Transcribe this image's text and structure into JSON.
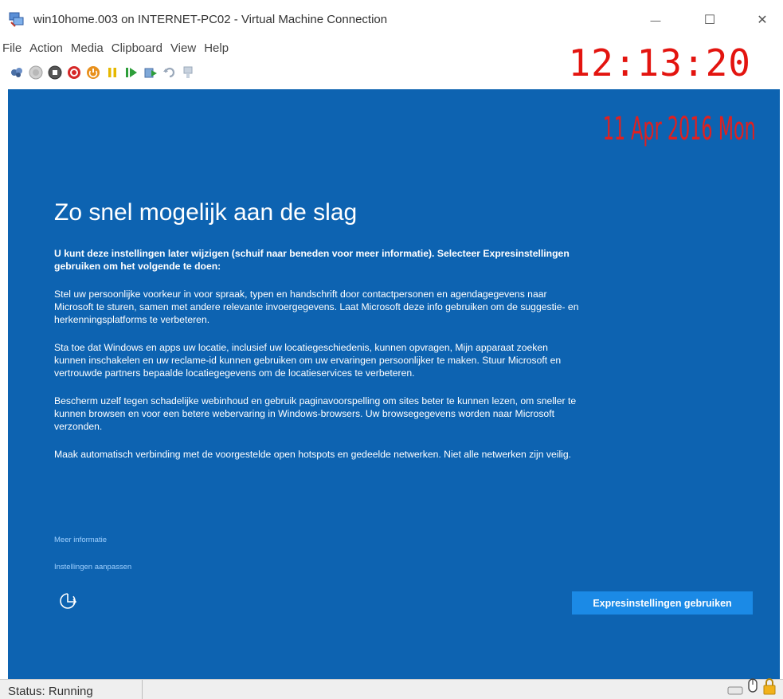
{
  "window": {
    "title": "win10home.003 on INTERNET-PC02 - Virtual Machine Connection",
    "minimize_glyph": "—",
    "maximize_glyph": "☐",
    "close_glyph": "✕"
  },
  "menu": [
    "File",
    "Action",
    "Media",
    "Clipboard",
    "View",
    "Help"
  ],
  "toolbar_icons": [
    "ctrl-alt-del-icon",
    "start-icon",
    "turn-off-icon",
    "shut-down-icon",
    "save-icon",
    "pause-icon",
    "resume-icon",
    "checkpoint-icon",
    "revert-icon",
    "enhanced-session-icon"
  ],
  "overlay": {
    "time": "12:13:20",
    "date": "11 Apr 2016 Mon",
    "color": "#e3140f"
  },
  "setup": {
    "heading": "Zo snel mogelijk aan de slag",
    "intro": "U kunt deze instellingen later wijzigen (schuif naar beneden voor meer informatie). Selecteer Expresinstellingen gebruiken om het volgende te doen:",
    "paragraphs": [
      "Stel uw persoonlijke voorkeur in voor spraak, typen en handschrift door contactpersonen en agendagegevens naar Microsoft te sturen, samen met andere relevante invoergegevens. Laat Microsoft deze info gebruiken om de suggestie- en herkenningsplatforms te verbeteren.",
      "Sta toe dat Windows en apps uw locatie, inclusief uw locatiegeschiedenis, kunnen opvragen, Mijn apparaat zoeken kunnen inschakelen en uw reclame-id kunnen gebruiken om uw ervaringen persoonlijker te maken. Stuur Microsoft en vertrouwde partners bepaalde locatiegegevens om de locatieservices te verbeteren.",
      "Bescherm uzelf tegen schadelijke webinhoud en gebruik paginavoorspelling om sites beter te kunnen lezen, om sneller te kunnen browsen en voor een betere webervaring in Windows-browsers. Uw browsegegevens worden naar Microsoft verzonden.",
      "Maak automatisch verbinding met de voorgestelde open hotspots en gedeelde netwerken. Niet alle netwerken zijn veilig."
    ],
    "link_more": "Meer informatie",
    "link_customize": "Instellingen aanpassen",
    "express_button": "Expresinstellingen gebruiken",
    "back_icon": "ease-of-access-icon",
    "background_color": "#0d63b1",
    "button_color": "#1b8ae6"
  },
  "status": {
    "text": "Status: Running",
    "tray_icons": [
      "keyboard-icon",
      "mouse-icon",
      "lock-icon"
    ]
  }
}
